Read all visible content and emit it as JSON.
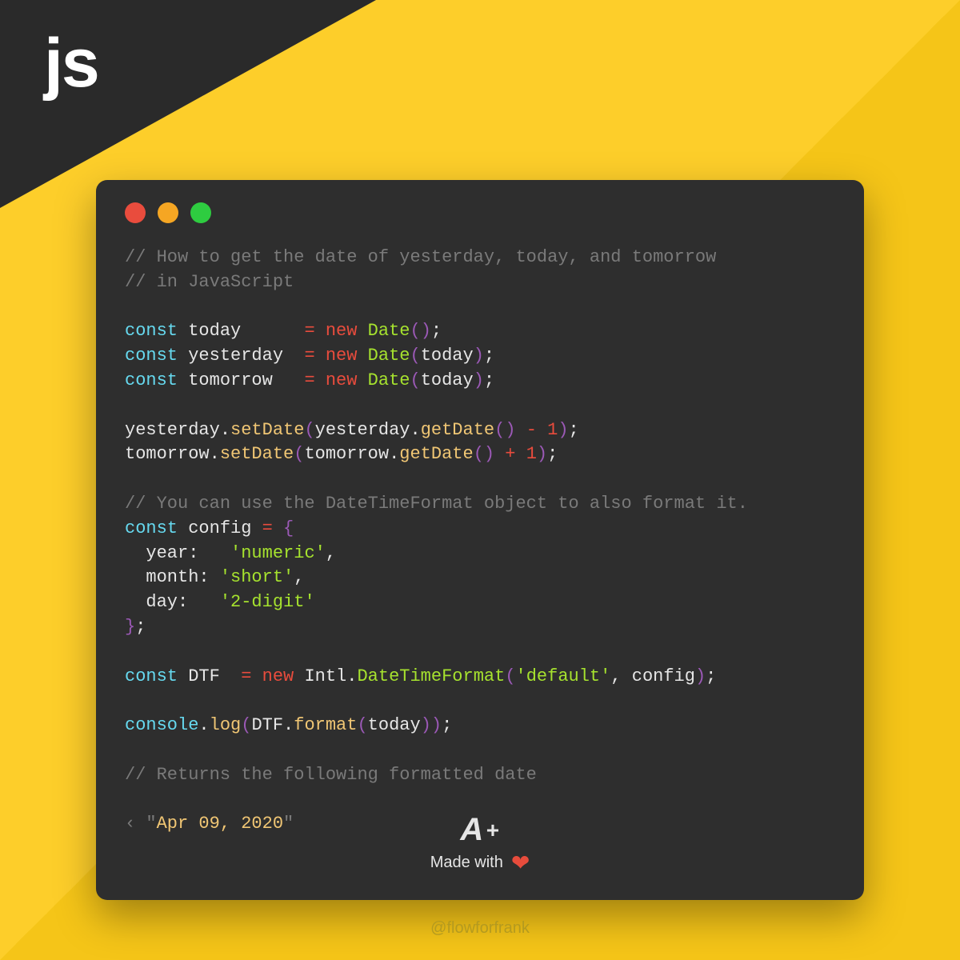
{
  "corner": {
    "logo": "js"
  },
  "code": {
    "comment1": "// How to get the date of yesterday, today, and tomorrow",
    "comment2": "// in JavaScript",
    "const": "const",
    "today": "today",
    "yesterday": "yesterday",
    "tomorrow": "tomorrow",
    "eq": " = ",
    "new": "new",
    "date": "Date",
    "setDate": "setDate",
    "getDate": "getDate",
    "minus1": " - 1",
    "plus1": " + 1",
    "comment3": "// You can use the DateTimeFormat object to also format it.",
    "config": "config",
    "year": "year",
    "month": "month",
    "day": "day",
    "numeric": "'numeric'",
    "short": "'short'",
    "twodigit": "'2-digit'",
    "dtf": "DTF",
    "intl": "Intl",
    "dtfclass": "DateTimeFormat",
    "default": "'default'",
    "console": "console",
    "log": "log",
    "format": "format",
    "comment4": "// Returns the following formatted date",
    "arrow": "‹",
    "output": "Apr 09, 2020",
    "semi": ";",
    "dot": ".",
    "comma": ", ",
    "colon": ":",
    "lbrace": "{",
    "rbrace": "}",
    "lparen": "(",
    "rparen": ")"
  },
  "footer": {
    "a": "A",
    "plus": "+",
    "made": "Made with"
  },
  "handle": "@flowforfrank"
}
